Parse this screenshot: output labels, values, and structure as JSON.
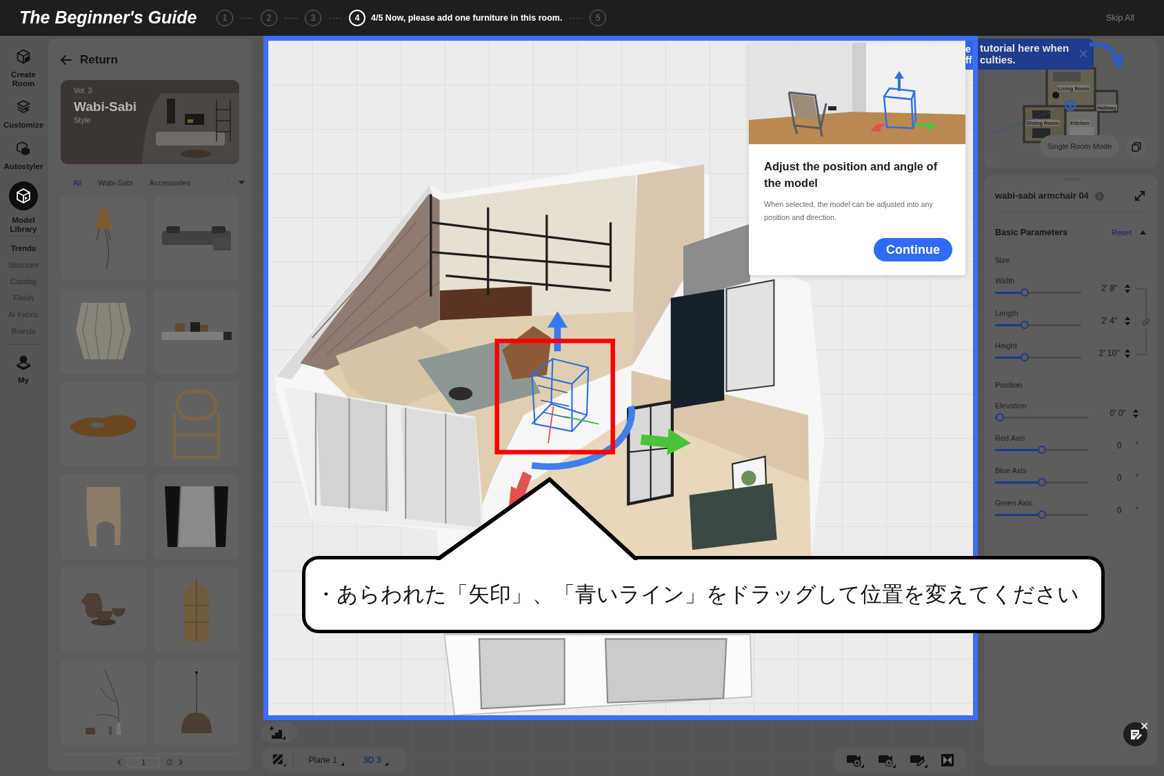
{
  "guide_bar": {
    "title": "The Beginner's Guide",
    "steps": [
      {
        "number": "1",
        "selected": false
      },
      {
        "number": "2",
        "selected": false
      },
      {
        "number": "3",
        "selected": false
      },
      {
        "number": "4",
        "selected": true,
        "text": "4/5 Now, please add one furniture in this room."
      },
      {
        "number": "5",
        "selected": false
      }
    ],
    "skip": "Skip All"
  },
  "sidebar": {
    "items": [
      {
        "label": "Create Room",
        "selected": false
      },
      {
        "label": "Customize",
        "selected": false
      },
      {
        "label": "Autostyler",
        "selected": false
      },
      {
        "label": "Model Library",
        "selected": true
      }
    ],
    "sub_items": [
      {
        "label": "Trends",
        "selected": true
      },
      {
        "label": "Structure",
        "selected": false
      },
      {
        "label": "Catalog",
        "selected": false
      },
      {
        "label": "Finish",
        "selected": false
      },
      {
        "label": "AI Fabric",
        "selected": false
      },
      {
        "label": "Brands",
        "selected": false
      }
    ],
    "account": {
      "label": "My"
    }
  },
  "library": {
    "back": "Return",
    "banner": {
      "volume": "Vol. 3",
      "title": "Wabi-Sabi",
      "subtitle": "Style"
    },
    "tabs": [
      {
        "label": "All",
        "selected": true
      },
      {
        "label": "Wabi-Sabi",
        "selected": false
      },
      {
        "label": "Accessories",
        "selected": false
      }
    ],
    "products": [
      {
        "kind": "lamp"
      },
      {
        "kind": "sofa"
      },
      {
        "kind": "basket"
      },
      {
        "kind": "daybed"
      },
      {
        "kind": "driftwood"
      },
      {
        "kind": "chair"
      },
      {
        "kind": "stool"
      },
      {
        "kind": "curtain"
      },
      {
        "kind": "pottery"
      },
      {
        "kind": "cabinet"
      },
      {
        "kind": "branch"
      },
      {
        "kind": "pendant"
      },
      {
        "kind": "blank"
      },
      {
        "kind": "blank"
      }
    ],
    "pagination": {
      "page": "1",
      "total": "/2"
    }
  },
  "viewport": {
    "tutorial_card": {
      "title": "Adjust the position and angle of the model",
      "text": "When selected, the model can be adjusted into any position and direction.",
      "button": "Continue"
    },
    "tooltip": {
      "cut_lines": [
        "e",
        "ff"
      ],
      "lines": [
        "tutorial here when",
        "culties."
      ]
    }
  },
  "annotation": {
    "text": "・あらわれた「矢印」、「青いライン」をドラッグして位置を変えてください"
  },
  "view_bar": {
    "views": [
      {
        "label": "Plane",
        "count": "1",
        "selected": false
      },
      {
        "label": "3D",
        "count": "3",
        "selected": true
      }
    ]
  },
  "minimap": {
    "rooms": [
      {
        "label": "Living Room"
      },
      {
        "label": "Hallway"
      },
      {
        "label": "Dining Room"
      },
      {
        "label": "Kitchen"
      }
    ],
    "mode_button": "Single Room Mode"
  },
  "properties": {
    "title": "wabi-sabi armchair 04",
    "section": "Basic Parameters",
    "reset": "Reset",
    "expanded": true,
    "groups": [
      {
        "heading": "Size",
        "kind": "linked",
        "params": [
          {
            "label": "Width",
            "kind": "stepper",
            "level": 0.32,
            "value": "2' 8\""
          },
          {
            "label": "Length",
            "kind": "stepper",
            "level": 0.32,
            "value": "2' 4\""
          },
          {
            "label": "Height",
            "kind": "stepper",
            "level": 0.32,
            "value": "2' 10\""
          }
        ]
      },
      {
        "heading": "Position",
        "kind": "free",
        "params": [
          {
            "label": "Elevation",
            "kind": "stepper",
            "level": 0,
            "value": "0' 0\""
          },
          {
            "label": "Red Axis",
            "kind": "angle",
            "level": 0.5,
            "value": "0",
            "unit": "°"
          },
          {
            "label": "Blue Axis",
            "kind": "angle",
            "level": 0.5,
            "value": "0",
            "unit": "°"
          },
          {
            "label": "Green Axis",
            "kind": "angle",
            "level": 0.5,
            "value": "0",
            "unit": "°"
          }
        ]
      }
    ]
  }
}
